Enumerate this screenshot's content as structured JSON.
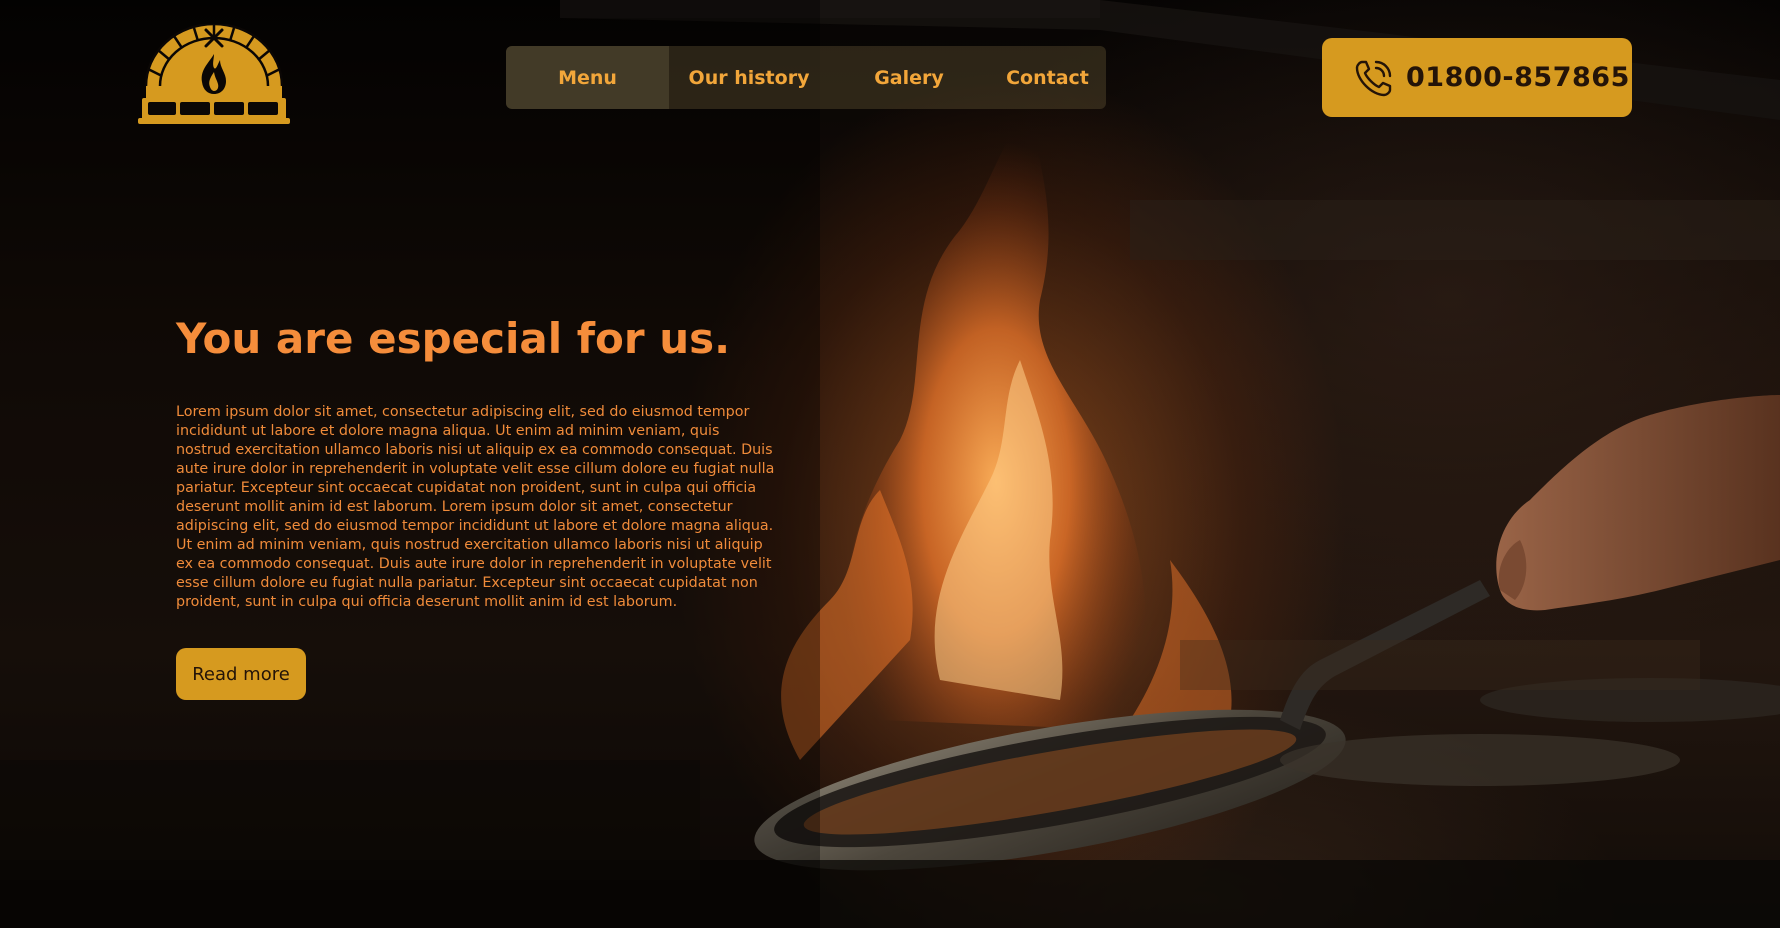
{
  "brand": {
    "logo_icon": "pizza-oven-icon"
  },
  "nav": {
    "items": [
      {
        "label": "Menu",
        "active": true
      },
      {
        "label": "Our history",
        "active": false
      },
      {
        "label": "Galery",
        "active": false
      },
      {
        "label": "Contact",
        "active": false
      }
    ]
  },
  "phone": {
    "icon": "phone-icon",
    "number": "01800-857865"
  },
  "hero": {
    "headline": "You are especial for us.",
    "body": "Lorem ipsum dolor sit amet, consectetur adipiscing elit, sed do eiusmod tempor incididunt ut labore et dolore magna aliqua. Ut enim ad minim veniam, quis nostrud exercitation ullamco laboris nisi ut aliquip ex ea commodo consequat. Duis aute irure dolor in reprehenderit in voluptate velit esse cillum dolore eu fugiat nulla pariatur. Excepteur sint occaecat cupidatat non proident, sunt in culpa qui officia deserunt mollit anim id est laborum. Lorem ipsum dolor sit amet, consectetur adipiscing elit, sed do eiusmod tempor incididunt ut labore et dolore magna aliqua. Ut enim ad minim veniam, quis nostrud exercitation ullamco laboris nisi ut aliquip ex ea commodo consequat. Duis aute irure dolor in reprehenderit in voluptate velit esse cillum dolore eu fugiat nulla pariatur. Excepteur sint occaecat cupidatat non proident, sunt in culpa qui officia deserunt mollit anim id est laborum.",
    "cta_label": "Read more"
  },
  "colors": {
    "accent": "#d69a1f",
    "headline": "#f58d3b",
    "nav_text": "#f2a63a",
    "button_text": "#241408"
  }
}
